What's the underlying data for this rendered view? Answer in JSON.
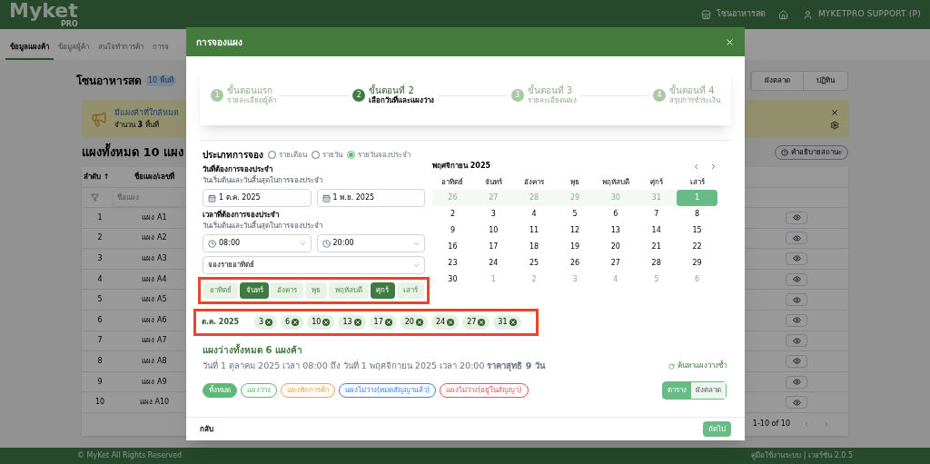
{
  "header": {
    "logo": "Myket",
    "logo_sub": "PRO",
    "zone": "โซนอาหารสด",
    "user": "MYKETPRO SUPPORT (P)"
  },
  "nav_tabs": [
    {
      "label": "ข้อมูลแผงค้า",
      "selected": true
    },
    {
      "label": "ข้อมูลผู้ค้า",
      "selected": false
    },
    {
      "label": "สนใจทำการค้า",
      "selected": false
    },
    {
      "label": "การจ",
      "selected": false
    }
  ],
  "page": {
    "title": "โซนอาหารสด",
    "badge": "10 พื้นที่",
    "view_tabs": [
      "ผังตลาด",
      "ปฏิทิน"
    ],
    "alert_title": "มีแผงค้าที่ใกล้หมด",
    "alert_subtitle": "จำนวน **3** พื้นที่",
    "heading": "แผงทั้งหมด 10 แผง",
    "status_button": "คำอธิบายสถานะ"
  },
  "table": {
    "columns": [
      "ลำดับ ↑",
      "ชื่อแผง/เลขที่"
    ],
    "filter_placeholder": "ชื่อแผง",
    "pagination": "1-10 of 10",
    "rows": [
      [
        "1",
        "แผง A1"
      ],
      [
        "2",
        "แผง A2"
      ],
      [
        "3",
        "แผง A3"
      ],
      [
        "4",
        "แผง A4"
      ],
      [
        "5",
        "แผง A5"
      ],
      [
        "6",
        "แผง A6"
      ],
      [
        "7",
        "แผง A7"
      ],
      [
        "8",
        "แผง A8"
      ],
      [
        "9",
        "แผง A9"
      ],
      [
        "10",
        "แผง A10"
      ]
    ]
  },
  "footer": {
    "left": "© MyKet All Rights Reserved",
    "right": "คู่มือใช้งานระบบ | เวอร์ชั่น 2.0.5"
  },
  "modal": {
    "title": "การจองแผง",
    "steps": [
      {
        "number": "1",
        "title": "ขั้นตอนแรก",
        "subtitle": "รายละเอียดผู้ค้า",
        "selected": false
      },
      {
        "number": "2",
        "title": "ขั้นตอนที่ 2",
        "subtitle": "เลือกวันที่และแผงว่าง",
        "selected": true
      },
      {
        "number": "3",
        "title": "ขั้นตอนที่ 3",
        "subtitle": "รายละเอียดแผง",
        "selected": false
      },
      {
        "number": "4",
        "title": "ขั้นตอนที่ 4",
        "subtitle": "สรุปการชำระเงิน",
        "selected": false
      }
    ],
    "booking_type": {
      "label": "ประเภทการจอง",
      "options": [
        {
          "label": "รายเดือน",
          "selected": false
        },
        {
          "label": "รายวัน",
          "selected": false
        },
        {
          "label": "รายวันจองประจำ",
          "selected": true
        }
      ]
    },
    "date_section": {
      "label": "วันที่ต้องการจองประจำ",
      "hint": "วันเริ่มต้นและวันสิ้นสุดในการจองประจำ",
      "start": "1 ต.ค. 2025",
      "end": "1 พ.ย. 2025"
    },
    "time_section": {
      "label": "เวลาที่ต้องการจองประจำ",
      "hint": "วันเริ่มต้นและวันสิ้นสุดในการจองประจำ",
      "start": "08:00",
      "end": "20:00",
      "repeat": "จองรายอาทิตย์"
    },
    "weekdays": [
      {
        "label": "อาทิตย์",
        "selected": false
      },
      {
        "label": "จันทร์",
        "selected": true
      },
      {
        "label": "อังคาร",
        "selected": false
      },
      {
        "label": "พุธ",
        "selected": false
      },
      {
        "label": "พฤหัสบดี",
        "selected": false
      },
      {
        "label": "ศุกร์",
        "selected": true
      },
      {
        "label": "เสาร์",
        "selected": false
      }
    ],
    "selected_dates": {
      "month": "ต.ค. 2025",
      "days": [
        "3",
        "6",
        "10",
        "13",
        "17",
        "20",
        "24",
        "27",
        "31"
      ]
    },
    "calendar": {
      "title": "พฤศจิกายน 2025",
      "weekdays": [
        "อาทิตย์",
        "จันทร์",
        "อังคาร",
        "พุธ",
        "พฤหัสบดี",
        "ศุกร์",
        "เสาร์"
      ],
      "days": [
        {
          "label": "26",
          "kind": "prev",
          "selected": false
        },
        {
          "label": "27",
          "kind": "prev",
          "selected": false
        },
        {
          "label": "28",
          "kind": "prev",
          "selected": false
        },
        {
          "label": "29",
          "kind": "prev",
          "selected": false
        },
        {
          "label": "30",
          "kind": "prev",
          "selected": false
        },
        {
          "label": "31",
          "kind": "prev",
          "selected": false
        },
        {
          "label": "1",
          "kind": "current",
          "selected": true
        },
        {
          "label": "2",
          "kind": "current",
          "selected": false
        },
        {
          "label": "3",
          "kind": "current",
          "selected": false
        },
        {
          "label": "4",
          "kind": "current",
          "selected": false
        },
        {
          "label": "5",
          "kind": "current",
          "selected": false
        },
        {
          "label": "6",
          "kind": "current",
          "selected": false
        },
        {
          "label": "7",
          "kind": "current",
          "selected": false
        },
        {
          "label": "8",
          "kind": "current",
          "selected": false
        },
        {
          "label": "9",
          "kind": "current",
          "selected": false
        },
        {
          "label": "10",
          "kind": "current",
          "selected": false
        },
        {
          "label": "11",
          "kind": "current",
          "selected": false
        },
        {
          "label": "12",
          "kind": "current",
          "selected": false
        },
        {
          "label": "13",
          "kind": "current",
          "selected": false
        },
        {
          "label": "14",
          "kind": "current",
          "selected": false
        },
        {
          "label": "15",
          "kind": "current",
          "selected": false
        },
        {
          "label": "16",
          "kind": "current",
          "selected": false
        },
        {
          "label": "17",
          "kind": "current",
          "selected": false
        },
        {
          "label": "18",
          "kind": "current",
          "selected": false
        },
        {
          "label": "19",
          "kind": "current",
          "selected": false
        },
        {
          "label": "20",
          "kind": "current",
          "selected": false
        },
        {
          "label": "21",
          "kind": "current",
          "selected": false
        },
        {
          "label": "22",
          "kind": "current",
          "selected": false
        },
        {
          "label": "23",
          "kind": "current",
          "selected": false
        },
        {
          "label": "24",
          "kind": "current",
          "selected": false
        },
        {
          "label": "25",
          "kind": "current",
          "selected": false
        },
        {
          "label": "26",
          "kind": "current",
          "selected": false
        },
        {
          "label": "27",
          "kind": "current",
          "selected": false
        },
        {
          "label": "28",
          "kind": "current",
          "selected": false
        },
        {
          "label": "29",
          "kind": "current",
          "selected": false
        },
        {
          "label": "30",
          "kind": "current",
          "selected": false
        },
        {
          "label": "1",
          "kind": "next",
          "selected": false
        },
        {
          "label": "2",
          "kind": "next",
          "selected": false
        },
        {
          "label": "3",
          "kind": "next",
          "selected": false
        },
        {
          "label": "4",
          "kind": "next",
          "selected": false
        },
        {
          "label": "5",
          "kind": "next",
          "selected": false
        },
        {
          "label": "6",
          "kind": "next",
          "selected": false
        }
      ]
    },
    "results": {
      "title": "แผงว่างทั้งหมด 6 แผงค้า",
      "summary": "วันที่ 1 ตุลาคม 2025 เวลา 08:00 ถึง วันที่ 1 พฤศจิกายน 2025 เวลา 20:00 **ราคาสุทธิ 9 วัน**",
      "refresh": "ค้นหาแผงว่างซ้ำ",
      "filters": [
        {
          "label": "ทั้งหมด",
          "selected": true,
          "color": "#5fb878"
        },
        {
          "label": "แผงว่าง",
          "selected": false,
          "color": "#5fb878"
        },
        {
          "label": "แผงพักการค้า",
          "selected": false,
          "color": "#f0a04b"
        },
        {
          "label": "แผงไม่ว่าง(หมดสัญญาแล้ว)",
          "selected": false,
          "color": "#3b82f6"
        },
        {
          "label": "แผงไม่ว่าง(อยู่ในสัญญา)",
          "selected": false,
          "color": "#e05555"
        }
      ],
      "views": [
        {
          "label": "ตาราง",
          "selected": true
        },
        {
          "label": "ผังตลาด",
          "selected": false
        }
      ]
    },
    "back": "กลับ",
    "next": "ถัดไป"
  }
}
